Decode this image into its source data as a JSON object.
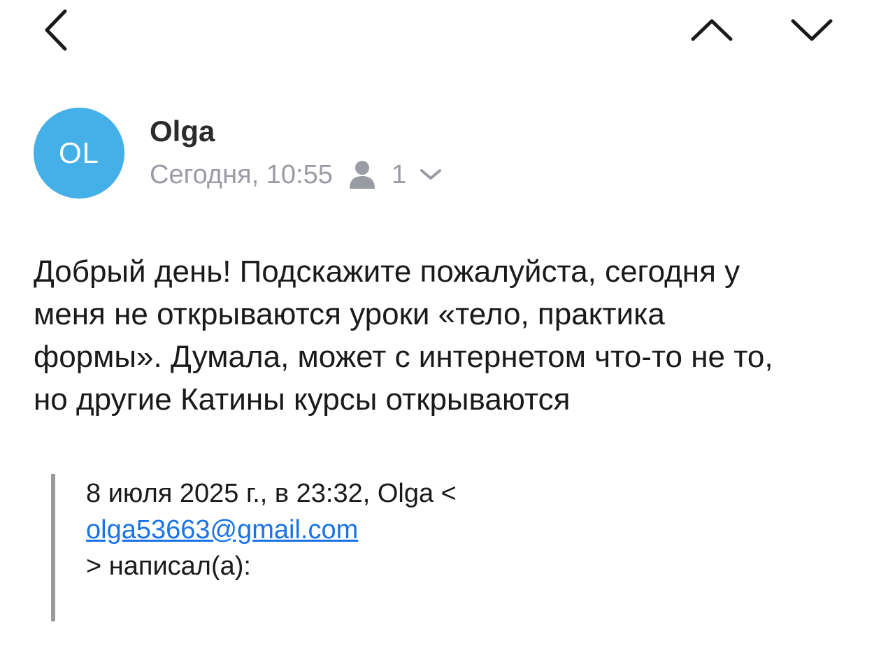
{
  "toolbar": {
    "back_icon": "chevron-left-icon",
    "prev_icon": "chevron-up-icon",
    "next_icon": "chevron-down-icon"
  },
  "message": {
    "avatar_initials": "OL",
    "avatar_color": "#45afe7",
    "sender_name": "Olga",
    "date": "Сегодня, 10:55",
    "recipients_icon": "person-icon",
    "recipients_count": "1",
    "body_lines": [
      "Добрый день! Подскажите пожалуйста, сегодня у",
      "меня не открываются уроки «тело, практика",
      "формы». Думала, может с интернетом что-то не то,",
      "но другие Катины курсы открываются"
    ]
  },
  "quote": {
    "header": "8 июля 2025 г., в 23:32, Olga <",
    "email": "olga53663@gmail.com",
    "footer": "> написал(а):"
  },
  "colors": {
    "link": "#1a73e8",
    "meta_text": "#9a9ca3",
    "quote_bar": "#9b9b9b"
  }
}
